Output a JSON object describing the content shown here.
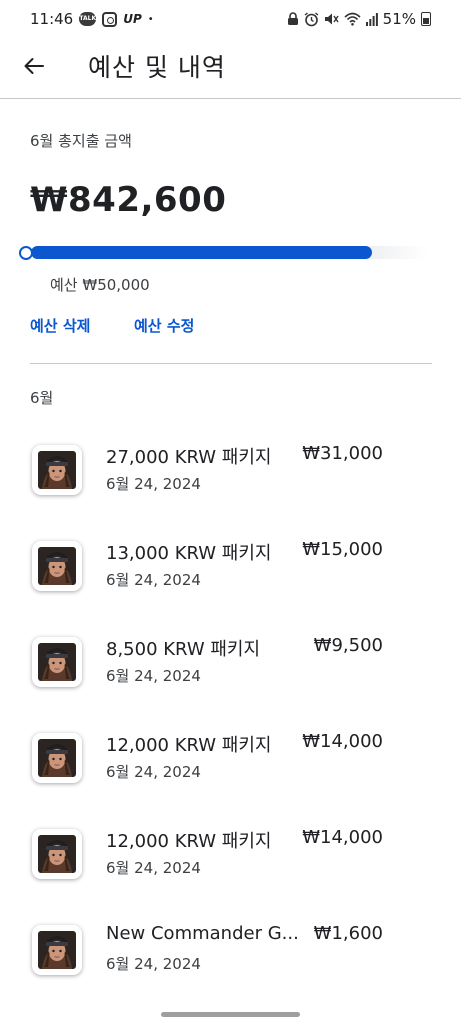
{
  "status_bar": {
    "time": "11:46",
    "talk_badge": "TALK",
    "up_badge": "UP",
    "notification_dot": "•",
    "battery_percent": "51%"
  },
  "app_bar": {
    "title": "예산 및 내역",
    "back_icon": "arrow-left-icon"
  },
  "summary": {
    "period_label": "6월 총지출 금액",
    "total_amount": "₩842,600",
    "budget_caption": "예산 ₩50,000",
    "progress_fraction": 0.86,
    "accent_color": "#0b57d0"
  },
  "actions": {
    "delete_budget": "예산 삭제",
    "edit_budget": "예산 수정"
  },
  "history": {
    "month_label": "6월",
    "items": [
      {
        "name": "27,000 KRW 패키지",
        "date": "6월 24, 2024",
        "amount": "₩31,000"
      },
      {
        "name": "13,000 KRW 패키지",
        "date": "6월 24, 2024",
        "amount": "₩15,000"
      },
      {
        "name": "8,500 KRW 패키지",
        "date": "6월 24, 2024",
        "amount": "₩9,500"
      },
      {
        "name": "12,000 KRW 패키지",
        "date": "6월 24, 2024",
        "amount": "₩14,000"
      },
      {
        "name": "12,000 KRW 패키지",
        "date": "6월 24, 2024",
        "amount": "₩14,000"
      },
      {
        "name": "New Commander G...",
        "date": "6월 24, 2024",
        "amount": "₩1,600"
      }
    ]
  }
}
